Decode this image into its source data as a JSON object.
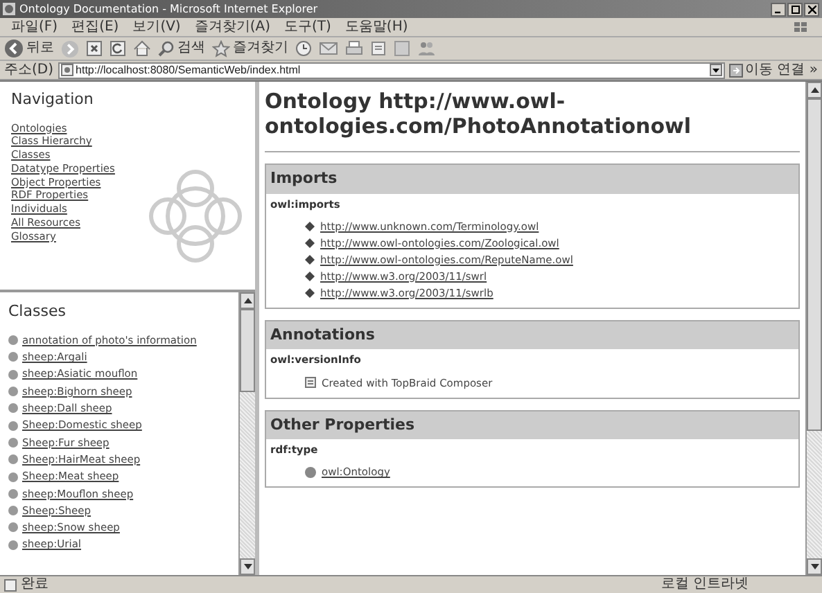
{
  "window": {
    "title": "Ontology Documentation - Microsoft Internet Explorer"
  },
  "menu_bar": [
    "파일(F)",
    "편집(E)",
    "보기(V)",
    "즐겨찾기(A)",
    "도구(T)",
    "도움말(H)"
  ],
  "toolbar": [
    {
      "kind": "back",
      "label": "뒤로"
    },
    {
      "kind": "forward"
    },
    {
      "kind": "stop"
    },
    {
      "kind": "refresh"
    },
    {
      "kind": "home"
    },
    {
      "kind": "search",
      "label": "검색"
    },
    {
      "kind": "favorites",
      "label": "즐겨찾기"
    },
    {
      "kind": "history"
    },
    {
      "kind": "mail"
    },
    {
      "kind": "print"
    },
    {
      "kind": "edit"
    },
    {
      "kind": "discuss"
    },
    {
      "kind": "messenger"
    }
  ],
  "address": {
    "label": "주소(D)",
    "value": "http://localhost:8080/SemanticWeb/index.html",
    "go": "이동",
    "links": "연결 »"
  },
  "navigation": {
    "title": "Navigation",
    "links": [
      "Ontologies",
      "Class Hierarchy",
      "Classes",
      "Datatype Properties",
      "Object Properties",
      "RDF Properties",
      "Individuals",
      "All Resources",
      "Glossary"
    ]
  },
  "classes": {
    "title": "Classes",
    "items": [
      "annotation of photo's information",
      "sheep:Argali",
      "sheep:Asiatic mouflon",
      "sheep:Bighorn sheep",
      "sheep:Dall sheep",
      "Sheep:Domestic sheep",
      "Sheep:Fur sheep",
      "Sheep:HairMeat sheep",
      "Sheep:Meat sheep",
      "sheep:Mouflon sheep",
      "Sheep:Sheep",
      "sheep:Snow sheep",
      "sheep:Urial"
    ]
  },
  "ontology": {
    "title": "Ontology http://www.owl-ontologies.com/PhotoAnnotationowl",
    "sections": [
      {
        "title": "Imports",
        "property": "owl:imports",
        "values": [
          {
            "kind": "import",
            "text": "http://www.unknown.com/Terminology.owl"
          },
          {
            "kind": "import",
            "text": "http://www.owl-ontologies.com/Zoological.owl"
          },
          {
            "kind": "import",
            "text": "http://www.owl-ontologies.com/ReputeName.owl"
          },
          {
            "kind": "import",
            "text": "http://www.w3.org/2003/11/swrl"
          },
          {
            "kind": "import",
            "text": "http://www.w3.org/2003/11/swrlb"
          }
        ]
      },
      {
        "title": "Annotations",
        "property": "owl:versionInfo",
        "values": [
          {
            "kind": "literal",
            "text": "Created with TopBraid Composer"
          }
        ]
      },
      {
        "title": "Other Properties",
        "property": "rdf:type",
        "values": [
          {
            "kind": "resource",
            "text": "owl:Ontology"
          }
        ]
      }
    ]
  },
  "status_bar": {
    "text": "완료",
    "zone": "로컬 인트라넷"
  }
}
